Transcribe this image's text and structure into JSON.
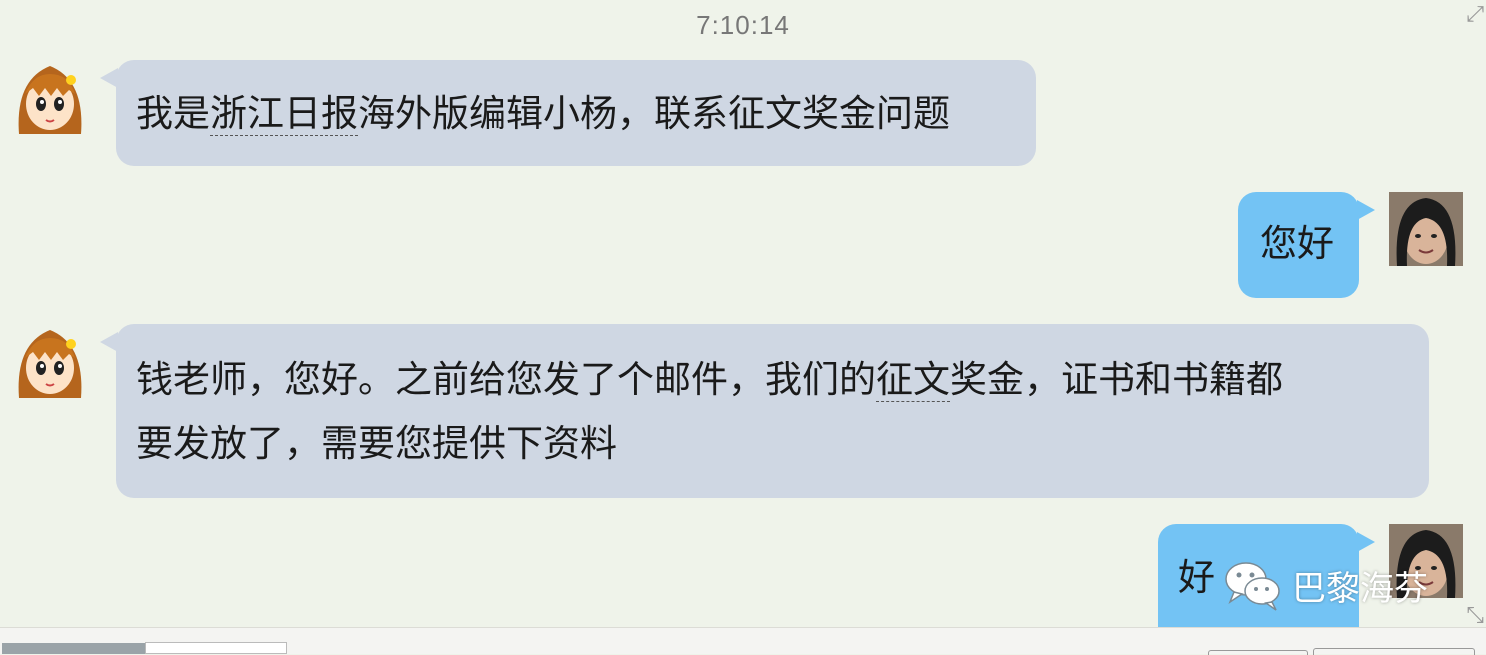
{
  "timestamp": "7:10:14",
  "messages": [
    {
      "side": "left",
      "avatar": "cartoon-girl-avatar",
      "segments": [
        "我是",
        "浙江日报",
        "海外版编辑小杨，联系征文奖金问题"
      ]
    },
    {
      "side": "right",
      "avatar": "user-photo-avatar",
      "text": "您好"
    },
    {
      "side": "left",
      "avatar": "cartoon-girl-avatar",
      "line1": [
        "钱老师，您好。之前给您发了个邮件，我们的",
        "征文",
        "奖金，证书和书籍都"
      ],
      "line2": "要发放了，需要您提供下资料"
    },
    {
      "side": "right",
      "avatar": "user-photo-avatar",
      "text": "好"
    }
  ],
  "watermark": {
    "icon": "wechat-icon",
    "text": "巴黎海芬"
  },
  "colors": {
    "background": "#eff3ea",
    "incoming_bubble": "#cfd7e3",
    "outgoing_bubble": "#73c3f4"
  }
}
